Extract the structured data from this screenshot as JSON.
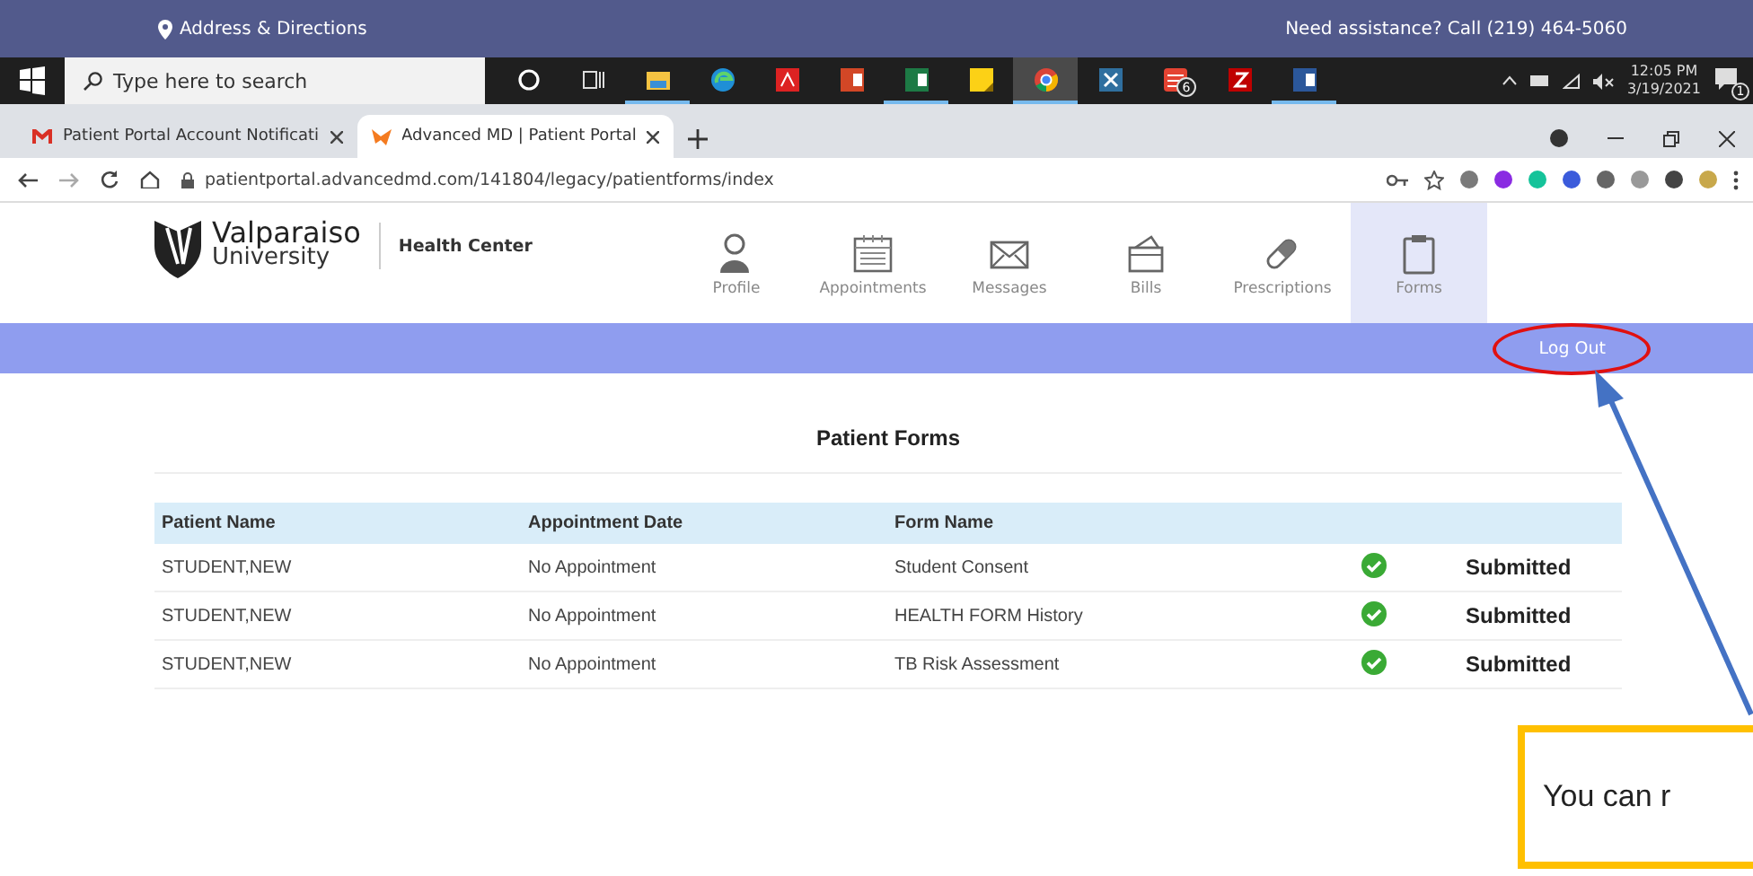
{
  "site_banner": {
    "address_link": "Address & Directions",
    "assistance": "Need assistance? Call (219) 464-5060"
  },
  "taskbar": {
    "search_placeholder": "Type here to search",
    "apps": [
      {
        "kind": "cortana",
        "open": false,
        "selected": false
      },
      {
        "kind": "taskview",
        "open": false,
        "selected": false
      },
      {
        "kind": "explorer",
        "open": true,
        "selected": false
      },
      {
        "kind": "edge",
        "open": false,
        "selected": false
      },
      {
        "kind": "acrobat",
        "open": false,
        "selected": false
      },
      {
        "kind": "powerpoint",
        "open": false,
        "selected": false
      },
      {
        "kind": "excel",
        "open": true,
        "selected": false
      },
      {
        "kind": "sticky",
        "open": false,
        "selected": false
      },
      {
        "kind": "chrome",
        "open": true,
        "selected": true
      },
      {
        "kind": "nx",
        "open": false,
        "selected": false
      },
      {
        "kind": "todoist",
        "open": false,
        "selected": false,
        "badge": "6"
      },
      {
        "kind": "filezilla",
        "open": false,
        "selected": false
      },
      {
        "kind": "word",
        "open": true,
        "selected": false
      }
    ],
    "time": "12:05 PM",
    "date": "3/19/2021",
    "notifications": "1"
  },
  "browser": {
    "tabs": [
      {
        "title": "Patient Portal Account Notificati",
        "kind": "mail",
        "selected": false
      },
      {
        "title": "Advanced MD | Patient Portal",
        "kind": "portal",
        "selected": true
      }
    ],
    "url": "patientportal.advancedmd.com/141804/legacy/patientforms/index"
  },
  "portal": {
    "logo_name": "Valparaiso",
    "logo_sub": "University",
    "department": "Health Center",
    "nav": [
      {
        "label": "Profile",
        "kind": "profile",
        "selected": false
      },
      {
        "label": "Appointments",
        "kind": "calendar",
        "selected": false
      },
      {
        "label": "Messages",
        "kind": "envelope",
        "selected": false
      },
      {
        "label": "Bills",
        "kind": "wallet",
        "selected": false
      },
      {
        "label": "Prescriptions",
        "kind": "pill",
        "selected": false
      },
      {
        "label": "Forms",
        "kind": "clipboard",
        "selected": true
      }
    ],
    "logout": "Log Out",
    "page_title": "Patient Forms",
    "table": {
      "columns": [
        "Patient Name",
        "Appointment Date",
        "Form Name"
      ],
      "rows": [
        {
          "cells": [
            "STUDENT,NEW",
            "No Appointment",
            "Student Consent"
          ],
          "complete": true,
          "status": "Submitted"
        },
        {
          "cells": [
            "STUDENT,NEW",
            "No Appointment",
            "HEALTH FORM History"
          ],
          "complete": true,
          "status": "Submitted"
        },
        {
          "cells": [
            "STUDENT,NEW",
            "No Appointment",
            "TB Risk Assessment"
          ],
          "complete": true,
          "status": "Submitted"
        }
      ]
    }
  },
  "annotation": {
    "text": "You can r"
  }
}
